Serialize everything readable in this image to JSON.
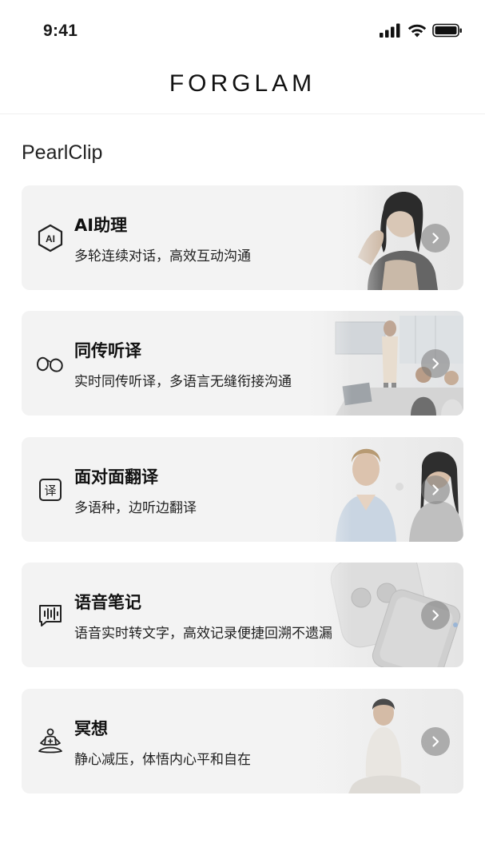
{
  "status_bar": {
    "time": "9:41",
    "icons": [
      "signal-icon",
      "wifi-icon",
      "battery-icon"
    ]
  },
  "header": {
    "brand": "FORGLAM"
  },
  "section": {
    "title": "PearlClip"
  },
  "cards": [
    {
      "title": "AI助理",
      "subtitle": "多轮连续对话，高效互动沟通",
      "icon": "ai-assistant-icon",
      "image": "woman-with-earbud-photo"
    },
    {
      "title": "同传听译",
      "subtitle": "实时同传听译，多语言无缝衔接沟通",
      "icon": "earbuds-icon",
      "image": "office-meeting-photo"
    },
    {
      "title": "面对面翻译",
      "subtitle": "多语种，边听边翻译",
      "icon": "translate-icon",
      "image": "two-women-talking-photo"
    },
    {
      "title": "语音笔记",
      "subtitle": "语音实时转文字，高效记录便捷回溯不遗漏",
      "icon": "voice-note-icon",
      "image": "earbuds-case-and-phone-photo"
    },
    {
      "title": "冥想",
      "subtitle": "静心减压，体悟内心平和自在",
      "icon": "meditation-icon",
      "image": "woman-meditating-photo"
    }
  ],
  "colors": {
    "card_background": "#f3f3f3",
    "text_primary": "#111111",
    "arrow_button": "#8a8a8a"
  }
}
